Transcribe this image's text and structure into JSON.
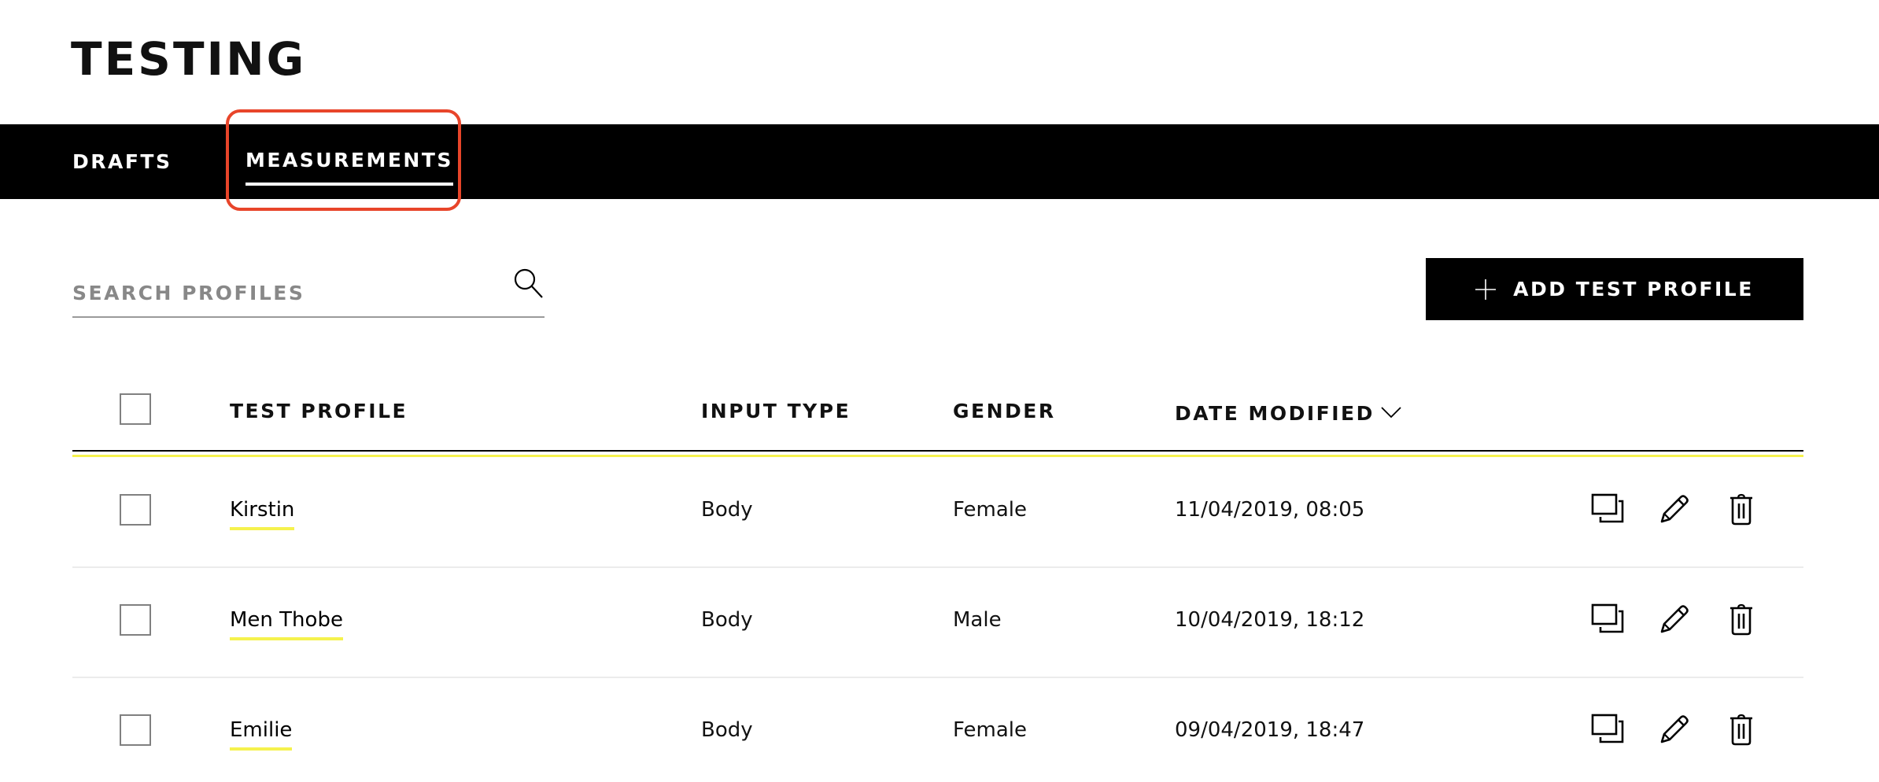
{
  "page": {
    "title": "TESTING"
  },
  "nav": {
    "tabs": [
      {
        "label": "DRAFTS",
        "active": false
      },
      {
        "label": "MEASUREMENTS",
        "active": true
      }
    ],
    "highlight_color": "#e8452a"
  },
  "toolbar": {
    "search_placeholder": "SEARCH PROFILES",
    "search_value": "",
    "search_icon": "search-icon",
    "add_button_label": "ADD TEST PROFILE",
    "add_button_icon": "plus-icon"
  },
  "table": {
    "columns": [
      {
        "label": "TEST PROFILE"
      },
      {
        "label": "INPUT TYPE"
      },
      {
        "label": "GENDER"
      },
      {
        "label": "DATE MODIFIED",
        "sort": "descending",
        "sort_icon": "chevron-down-icon"
      }
    ],
    "rows": [
      {
        "name": "Kirstin",
        "input_type": "Body",
        "gender": "Female",
        "date_modified": "11/04/2019, 08:05",
        "checked": false
      },
      {
        "name": "Men Thobe",
        "input_type": "Body",
        "gender": "Male",
        "date_modified": "10/04/2019, 18:12",
        "checked": false
      },
      {
        "name": "Emilie",
        "input_type": "Body",
        "gender": "Female",
        "date_modified": "09/04/2019, 18:47",
        "checked": false
      }
    ],
    "row_actions": [
      "duplicate-icon",
      "pencil-icon",
      "trash-icon"
    ]
  },
  "colors": {
    "accent_yellow": "#f5f24d",
    "nav_background": "#000000",
    "button_background": "#000000"
  }
}
